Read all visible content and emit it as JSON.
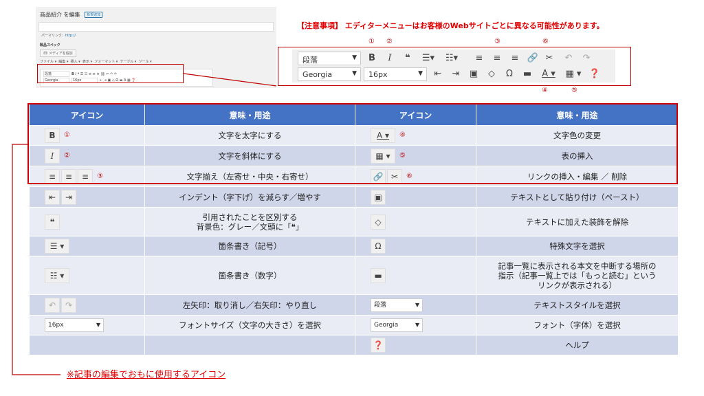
{
  "thumbnail": {
    "title": "商品紹介 を編集",
    "new_button": "新規追加",
    "permalink_label": "パーマリンク:",
    "permalink_url": "http://",
    "spec_label": "製品スペック",
    "add_media": "メディアを追加",
    "menu_items": [
      "ファイル ▾",
      "編集 ▾",
      "挿入 ▾",
      "表示 ▾",
      "フォーマット ▾",
      "テーブル ▾",
      "ツール ▾"
    ],
    "format_select": "段落",
    "font_select": "Georgia",
    "size_select": "16px"
  },
  "notice": "【注意事項】 エディターメニューはお客様のWebサイトごとに異なる可能性があります。",
  "toolbar": {
    "format_value": "段落",
    "font_value": "Georgia",
    "size_value": "16px",
    "markers": {
      "m1": "①",
      "m2": "②",
      "m3": "③",
      "m4": "④",
      "m5": "⑤",
      "m6": "⑥"
    }
  },
  "table": {
    "headers": [
      "アイコン",
      "意味・用途",
      "アイコン",
      "意味・用途"
    ],
    "rows": [
      {
        "left_marker": "①",
        "left_desc": "文字を太字にする",
        "right_marker": "④",
        "right_desc": "文字色の変更"
      },
      {
        "left_marker": "②",
        "left_desc": "文字を斜体にする",
        "right_marker": "⑤",
        "right_desc": "表の挿入"
      },
      {
        "left_marker": "③",
        "left_desc": "文字揃え（左寄せ・中央・右寄せ）",
        "right_marker": "⑥",
        "right_desc": "リンクの挿入・編集 ／ 削除"
      },
      {
        "left_desc": "インデント（字下げ）を減らす／増やす",
        "right_desc": "テキストとして貼り付け（ペースト）"
      },
      {
        "left_desc_line1": "引用されたことを区別する",
        "left_desc_line2": "背景色：グレー／文頭に「❝」",
        "right_desc": "テキストに加えた装飾を解除"
      },
      {
        "left_desc": "箇条書き（記号）",
        "right_desc": "特殊文字を選択"
      },
      {
        "left_desc": "箇条書き（数字）",
        "right_desc_line1": "記事一覧に表示される本文を中断する場所の",
        "right_desc_line2": "指示（記事一覧上では「もっと読む」という",
        "right_desc_line3": "リンクが表示される）"
      },
      {
        "left_desc": "左矢印：取り消し／右矢印：やり直し",
        "right_select": "段落",
        "right_desc": "テキストスタイルを選択"
      },
      {
        "left_select": "16px",
        "left_desc": "フォントサイズ（文字の大きさ）を選択",
        "right_select": "Georgia",
        "right_desc": "フォント（字体）を選択"
      },
      {
        "right_desc": "ヘルプ"
      }
    ]
  },
  "footnote": "※記事の編集でおもに使用するアイコン",
  "colors": {
    "header_blue": "#4472c4",
    "accent_red": "#d00000",
    "row_light": "#e9ecf5",
    "row_dark": "#d0d6ea"
  }
}
